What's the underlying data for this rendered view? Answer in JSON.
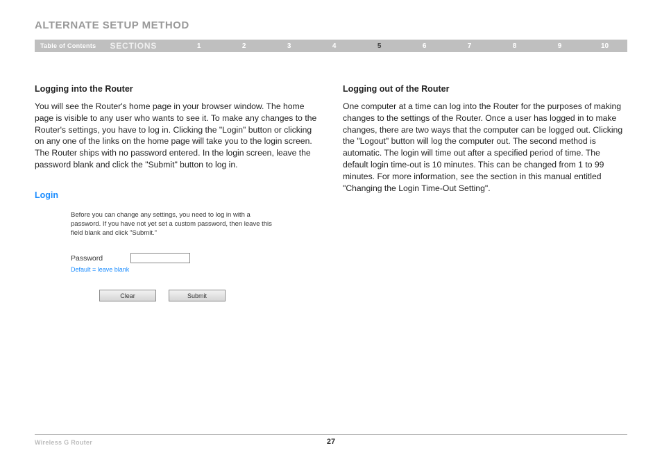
{
  "header": {
    "title": "ALTERNATE SETUP METHOD"
  },
  "nav": {
    "toc_label": "Table of Contents",
    "sections_label": "SECTIONS",
    "items": [
      "1",
      "2",
      "3",
      "4",
      "5",
      "6",
      "7",
      "8",
      "9",
      "10"
    ],
    "active": "5"
  },
  "left": {
    "heading": "Logging into the Router",
    "body": "You will see the Router's home page in your browser window. The home page is visible to any user who wants to see it. To make any changes to the Router's settings, you have to log in. Clicking the \"Login\" button or clicking on any one of the links on the home page will take you to the login screen. The Router ships with no password entered. In the login screen, leave the password blank and click the \"Submit\" button to log in."
  },
  "right": {
    "heading": "Logging out of the Router",
    "body": "One computer at a time can log into the Router for the purposes of making changes to the settings of the Router. Once a user has logged in to make changes, there are two ways that the computer can be logged out. Clicking the \"Logout\" button will log the computer out. The second method is automatic. The login will time out after a specified period of time. The default login time-out is 10 minutes. This can be changed from 1 to 99 minutes. For more information, see the section in this manual entitled \"Changing the Login Time-Out Setting\"."
  },
  "login_panel": {
    "title": "Login",
    "instructions": "Before you can change any settings, you need to log in with a password. If you have not yet set a custom password, then leave this field blank and click \"Submit.\"",
    "password_label": "Password",
    "password_value": "",
    "hint": "Default = leave blank",
    "clear_label": "Clear",
    "submit_label": "Submit"
  },
  "footer": {
    "product": "Wireless G Router",
    "page_number": "27"
  }
}
